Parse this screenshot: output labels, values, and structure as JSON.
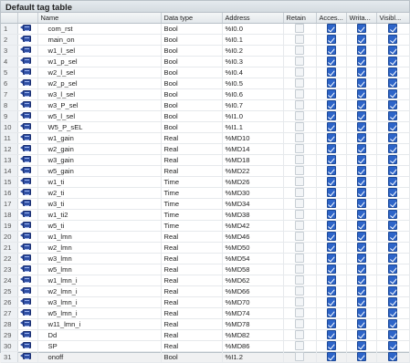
{
  "title": "Default tag table",
  "columns": {
    "num": "",
    "icon": "",
    "name": "Name",
    "data_type": "Data type",
    "address": "Address",
    "retain": "Retain",
    "accessible": "Acces...",
    "writable": "Writa...",
    "visible": "Visibl..."
  },
  "colors": {
    "checkbox_checked": "#2d64c8",
    "tag_icon": "#2f4fa4",
    "header_bg": "#e3e8ec"
  },
  "icons": {
    "row": "tag-icon"
  },
  "rows": [
    {
      "num": "1",
      "name": "com_rst",
      "type": "Bool",
      "address": "%I0.0",
      "retain": false,
      "accessible": true,
      "writable": true,
      "visible": true
    },
    {
      "num": "2",
      "name": "main_on",
      "type": "Bool",
      "address": "%I0.1",
      "retain": false,
      "accessible": true,
      "writable": true,
      "visible": true
    },
    {
      "num": "3",
      "name": "w1_l_sel",
      "type": "Bool",
      "address": "%I0.2",
      "retain": false,
      "accessible": true,
      "writable": true,
      "visible": true
    },
    {
      "num": "4",
      "name": "w1_p_sel",
      "type": "Bool",
      "address": "%I0.3",
      "retain": false,
      "accessible": true,
      "writable": true,
      "visible": true
    },
    {
      "num": "5",
      "name": "w2_l_sel",
      "type": "Bool",
      "address": "%I0.4",
      "retain": false,
      "accessible": true,
      "writable": true,
      "visible": true
    },
    {
      "num": "6",
      "name": "w2_p_sel",
      "type": "Bool",
      "address": "%I0.5",
      "retain": false,
      "accessible": true,
      "writable": true,
      "visible": true
    },
    {
      "num": "7",
      "name": "w3_l_sel",
      "type": "Bool",
      "address": "%I0.6",
      "retain": false,
      "accessible": true,
      "writable": true,
      "visible": true
    },
    {
      "num": "8",
      "name": "w3_P_sel",
      "type": "Bool",
      "address": "%I0.7",
      "retain": false,
      "accessible": true,
      "writable": true,
      "visible": true
    },
    {
      "num": "9",
      "name": "w5_l_sel",
      "type": "Bool",
      "address": "%I1.0",
      "retain": false,
      "accessible": true,
      "writable": true,
      "visible": true
    },
    {
      "num": "10",
      "name": "W5_P_sEL",
      "type": "Bool",
      "address": "%I1.1",
      "retain": false,
      "accessible": true,
      "writable": true,
      "visible": true
    },
    {
      "num": "11",
      "name": "w1_gain",
      "type": "Real",
      "address": "%MD10",
      "retain": false,
      "accessible": true,
      "writable": true,
      "visible": true
    },
    {
      "num": "12",
      "name": "w2_gain",
      "type": "Real",
      "address": "%MD14",
      "retain": false,
      "accessible": true,
      "writable": true,
      "visible": true
    },
    {
      "num": "13",
      "name": "w3_gain",
      "type": "Real",
      "address": "%MD18",
      "retain": false,
      "accessible": true,
      "writable": true,
      "visible": true
    },
    {
      "num": "14",
      "name": "w5_gain",
      "type": "Real",
      "address": "%MD22",
      "retain": false,
      "accessible": true,
      "writable": true,
      "visible": true
    },
    {
      "num": "15",
      "name": "w1_ti",
      "type": "Time",
      "address": "%MD26",
      "retain": false,
      "accessible": true,
      "writable": true,
      "visible": true
    },
    {
      "num": "16",
      "name": "w2_ti",
      "type": "Time",
      "address": "%MD30",
      "retain": false,
      "accessible": true,
      "writable": true,
      "visible": true
    },
    {
      "num": "17",
      "name": "w3_ti",
      "type": "Time",
      "address": "%MD34",
      "retain": false,
      "accessible": true,
      "writable": true,
      "visible": true
    },
    {
      "num": "18",
      "name": "w1_ti2",
      "type": "Time",
      "address": "%MD38",
      "retain": false,
      "accessible": true,
      "writable": true,
      "visible": true
    },
    {
      "num": "19",
      "name": "w5_ti",
      "type": "Time",
      "address": "%MD42",
      "retain": false,
      "accessible": true,
      "writable": true,
      "visible": true
    },
    {
      "num": "20",
      "name": "w1_lmn",
      "type": "Real",
      "address": "%MD46",
      "retain": false,
      "accessible": true,
      "writable": true,
      "visible": true
    },
    {
      "num": "21",
      "name": "w2_lmn",
      "type": "Real",
      "address": "%MD50",
      "retain": false,
      "accessible": true,
      "writable": true,
      "visible": true
    },
    {
      "num": "22",
      "name": "w3_lmn",
      "type": "Real",
      "address": "%MD54",
      "retain": false,
      "accessible": true,
      "writable": true,
      "visible": true
    },
    {
      "num": "23",
      "name": "w5_lmn",
      "type": "Real",
      "address": "%MD58",
      "retain": false,
      "accessible": true,
      "writable": true,
      "visible": true
    },
    {
      "num": "24",
      "name": "w1_lmn_i",
      "type": "Real",
      "address": "%MD62",
      "retain": false,
      "accessible": true,
      "writable": true,
      "visible": true
    },
    {
      "num": "25",
      "name": "w2_lmn_i",
      "type": "Real",
      "address": "%MD66",
      "retain": false,
      "accessible": true,
      "writable": true,
      "visible": true
    },
    {
      "num": "26",
      "name": "w3_lmn_i",
      "type": "Real",
      "address": "%MD70",
      "retain": false,
      "accessible": true,
      "writable": true,
      "visible": true
    },
    {
      "num": "27",
      "name": "w5_lmn_i",
      "type": "Real",
      "address": "%MD74",
      "retain": false,
      "accessible": true,
      "writable": true,
      "visible": true
    },
    {
      "num": "28",
      "name": "w11_lmn_i",
      "type": "Real",
      "address": "%MD78",
      "retain": false,
      "accessible": true,
      "writable": true,
      "visible": true
    },
    {
      "num": "29",
      "name": "Dd",
      "type": "Real",
      "address": "%MD82",
      "retain": false,
      "accessible": true,
      "writable": true,
      "visible": true
    },
    {
      "num": "30",
      "name": "SP",
      "type": "Real",
      "address": "%MD86",
      "retain": false,
      "accessible": true,
      "writable": true,
      "visible": true
    },
    {
      "num": "31",
      "name": "onoff",
      "type": "Bool",
      "address": "%I1.2",
      "retain": false,
      "accessible": true,
      "writable": true,
      "visible": true
    }
  ]
}
